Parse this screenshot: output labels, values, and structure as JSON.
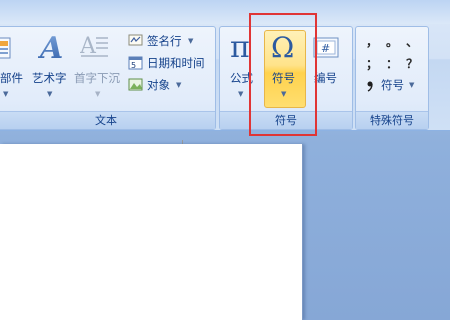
{
  "ribbon": {
    "text_group": {
      "label": "文本",
      "items": {
        "parts_label": "部件",
        "wordart_label": "艺术字",
        "dropcap_label": "首字下沉",
        "signature_label": "签名行",
        "datetime_label": "日期和时间",
        "object_label": "对象"
      }
    },
    "symbols_group": {
      "label": "符号",
      "equation_label": "公式",
      "symbol_label": "符号",
      "numbering_label": "编号"
    },
    "special_group": {
      "label": "特殊符号",
      "symbol_label": "符号",
      "punctuation": [
        "，",
        "。",
        "、",
        "；",
        "：",
        "？"
      ]
    }
  },
  "colors": {
    "ribbon_text": "#15428b",
    "highlight": "#ffd24d",
    "annotation": "#e03535"
  }
}
